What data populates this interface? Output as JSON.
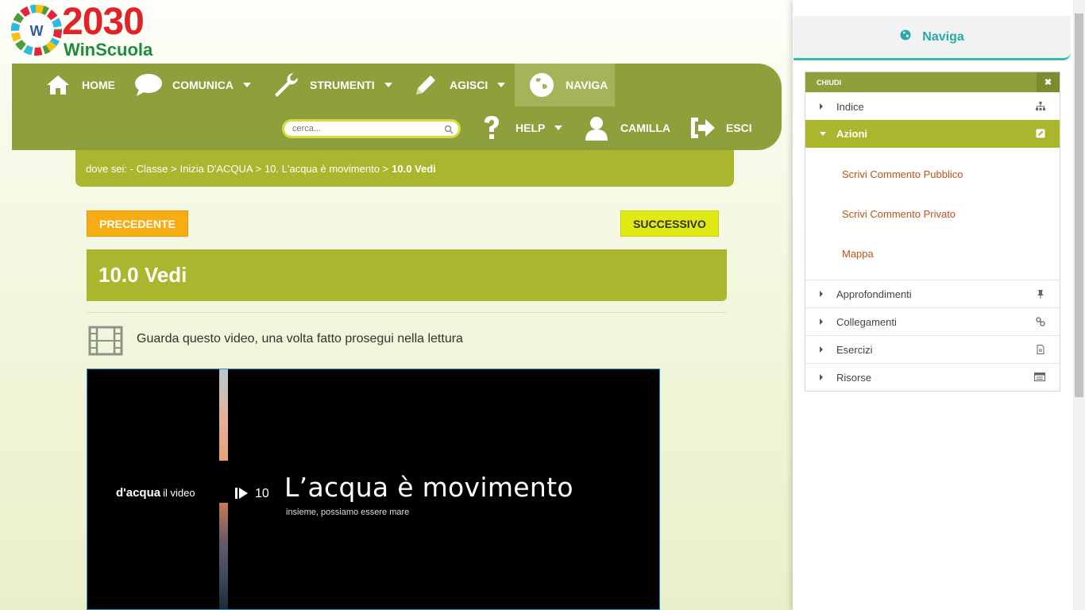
{
  "logo": {
    "big": "2030",
    "small": "WinScuola",
    "letter": "W"
  },
  "nav": {
    "home": "HOME",
    "comunica": "COMUNICA",
    "strumenti": "STRUMENTI",
    "agisci": "AGISCI",
    "naviga": "NAVIGA",
    "help": "HELP",
    "user": "CAMILLA",
    "esci": "ESCI"
  },
  "search": {
    "placeholder": "cerca..."
  },
  "breadcrumb": {
    "prefix": "dove sei: - Classe >",
    "item1": "Inizia D'ACQUA >",
    "item2": "10. L'acqua è movimento >",
    "current": "10.0 Vedi"
  },
  "buttons": {
    "prev": "PRECEDENTE",
    "next": "SUCCESSIVO"
  },
  "page_title": "10.0 Vedi",
  "instruction": "Guarda questo video, una volta fatto prosegui nella lettura",
  "video": {
    "brand": "d'acqua",
    "brand_suffix": "il video",
    "number": "10",
    "title": "L’acqua è movimento",
    "subtitle": "insieme, possiamo essere mare"
  },
  "panel": {
    "title": "Naviga",
    "close": "CHIUDI",
    "items": [
      {
        "label": "Indice"
      },
      {
        "label": "Azioni"
      },
      {
        "label": "Approfondimenti"
      },
      {
        "label": "Collegamenti"
      },
      {
        "label": "Esercizi"
      },
      {
        "label": "Risorse"
      }
    ],
    "actions": [
      "Scrivi Commento Pubblico",
      "Scrivi Commento Privato",
      "Mappa"
    ]
  },
  "colors": {
    "nav": "#8ea03c",
    "accent": "#aab72e",
    "prev": "#f8ac13",
    "next": "#dfe912",
    "link": "#c0531a",
    "teal": "#27aaa5"
  }
}
